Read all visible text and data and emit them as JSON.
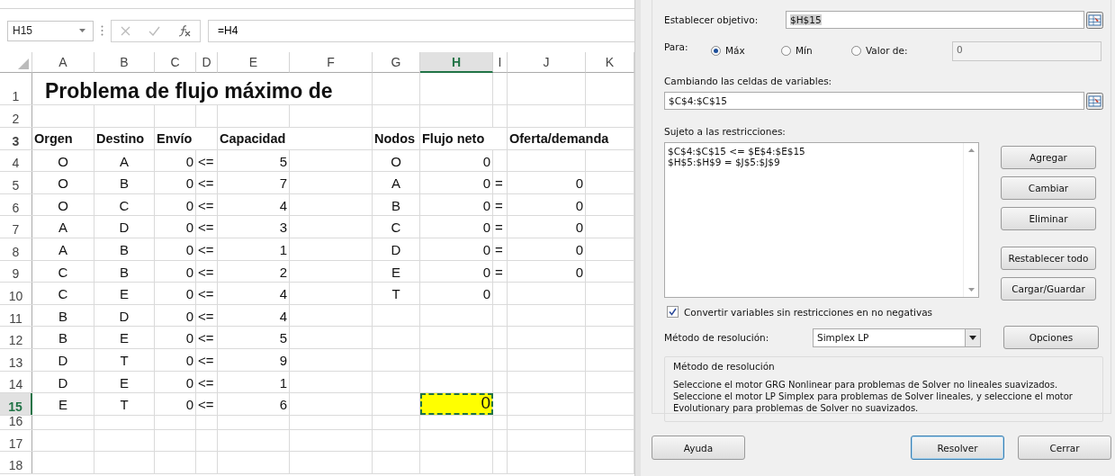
{
  "spreadsheet": {
    "name_box": "H15",
    "formula": "=H4",
    "columns": [
      {
        "label": "A",
        "selected": false
      },
      {
        "label": "B",
        "selected": false
      },
      {
        "label": "C",
        "selected": false
      },
      {
        "label": "D",
        "selected": false
      },
      {
        "label": "E",
        "selected": false
      },
      {
        "label": "F",
        "selected": false
      },
      {
        "label": "G",
        "selected": false
      },
      {
        "label": "H",
        "selected": true
      },
      {
        "label": "I",
        "selected": false
      },
      {
        "label": "J",
        "selected": false
      },
      {
        "label": "K",
        "selected": false
      }
    ],
    "rows": [
      {
        "number": "1",
        "kind": "title",
        "selected": false,
        "title": "Problema de flujo máximo de"
      },
      {
        "number": "2",
        "kind": "blank",
        "selected": false
      },
      {
        "number": "3",
        "kind": "header",
        "selected": false,
        "cells": [
          "Orgen",
          "Destino",
          "Envío",
          null,
          "Capacidad",
          null,
          "Nodos",
          "Flujo neto",
          null,
          "Oferta/demanda",
          null
        ]
      },
      {
        "number": "4",
        "kind": "data",
        "selected": false,
        "cells": [
          "O",
          "A",
          "0",
          "<=",
          "5",
          null,
          "O",
          "0",
          null,
          null,
          null
        ]
      },
      {
        "number": "5",
        "kind": "data",
        "selected": false,
        "cells": [
          "O",
          "B",
          "0",
          "<=",
          "7",
          null,
          "A",
          "0",
          "=",
          "0",
          null
        ]
      },
      {
        "number": "6",
        "kind": "data",
        "selected": false,
        "cells": [
          "O",
          "C",
          "0",
          "<=",
          "4",
          null,
          "B",
          "0",
          "=",
          "0",
          null
        ]
      },
      {
        "number": "7",
        "kind": "data",
        "selected": false,
        "cells": [
          "A",
          "D",
          "0",
          "<=",
          "3",
          null,
          "C",
          "0",
          "=",
          "0",
          null
        ]
      },
      {
        "number": "8",
        "kind": "data",
        "selected": false,
        "cells": [
          "A",
          "B",
          "0",
          "<=",
          "1",
          null,
          "D",
          "0",
          "=",
          "0",
          null
        ]
      },
      {
        "number": "9",
        "kind": "data",
        "selected": false,
        "cells": [
          "C",
          "B",
          "0",
          "<=",
          "2",
          null,
          "E",
          "0",
          "=",
          "0",
          null
        ]
      },
      {
        "number": "10",
        "kind": "data",
        "selected": false,
        "cells": [
          "C",
          "E",
          "0",
          "<=",
          "4",
          null,
          "T",
          "0",
          null,
          null,
          null
        ]
      },
      {
        "number": "11",
        "kind": "data",
        "selected": false,
        "cells": [
          "B",
          "D",
          "0",
          "<=",
          "4",
          null,
          null,
          null,
          null,
          null,
          null
        ]
      },
      {
        "number": "12",
        "kind": "data",
        "selected": false,
        "cells": [
          "B",
          "E",
          "0",
          "<=",
          "5",
          null,
          null,
          null,
          null,
          null,
          null
        ]
      },
      {
        "number": "13",
        "kind": "data",
        "selected": false,
        "cells": [
          "D",
          "T",
          "0",
          "<=",
          "9",
          null,
          null,
          null,
          null,
          null,
          null
        ]
      },
      {
        "number": "14",
        "kind": "data",
        "selected": false,
        "cells": [
          "D",
          "E",
          "0",
          "<=",
          "1",
          null,
          null,
          null,
          null,
          null,
          null
        ]
      },
      {
        "number": "15",
        "kind": "data",
        "selected": true,
        "cells": [
          "E",
          "T",
          "0",
          "<=",
          "6",
          null,
          null,
          "0",
          null,
          null,
          null
        ]
      },
      {
        "number": "16",
        "kind": "short",
        "selected": false
      },
      {
        "number": "17",
        "kind": "blank",
        "selected": false
      },
      {
        "number": "18",
        "kind": "blank",
        "selected": false
      }
    ]
  },
  "solver": {
    "objective": {
      "label": "Establecer objetivo:",
      "value": "$H$15"
    },
    "to": {
      "label": "Para:",
      "options": [
        {
          "label": "Máx",
          "selected": true
        },
        {
          "label": "Mín",
          "selected": false
        },
        {
          "label": "Valor de:",
          "selected": false
        }
      ],
      "value": "0",
      "disabled": true
    },
    "variables": {
      "label": "Cambiando las celdas de variables:",
      "value": "$C$4:$C$15"
    },
    "constraints": {
      "label": "Sujeto a las restricciones:",
      "items": [
        "$C$4:$C$15 <= $E$4:$E$15",
        "$H$5:$H$9 = $J$5:$J$9"
      ]
    },
    "side_buttons": [
      "Agregar",
      "Cambiar",
      "Eliminar",
      "Restablecer todo",
      "Cargar/Guardar"
    ],
    "nonnegative": {
      "label": "Convertir variables sin restricciones en no negativas",
      "checked": true
    },
    "method": {
      "label": "Método de resolución:",
      "value": "Simplex LP",
      "options_button": "Opciones"
    },
    "method_box": {
      "title": "Método de resolución",
      "text": "Seleccione el motor GRG Nonlinear para problemas de Solver no lineales suavizados. Seleccione el motor LP Simplex para problemas de Solver lineales, y seleccione el motor Evolutionary para problemas de Solver no suavizados."
    },
    "bottom_buttons": [
      {
        "label": "Ayuda",
        "default": false
      },
      {
        "label": "Resolver",
        "default": true
      },
      {
        "label": "Cerrar",
        "default": false
      }
    ]
  }
}
